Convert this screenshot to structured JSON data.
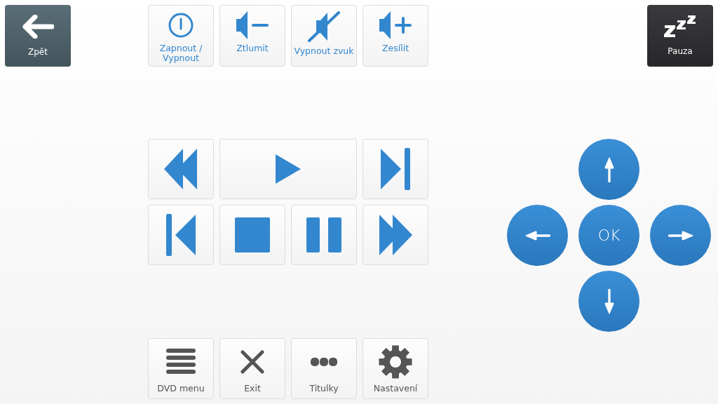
{
  "back_button": {
    "label": "Zpět"
  },
  "pause_button": {
    "label": "Pauza"
  },
  "top_buttons": [
    {
      "label": "Zapnout / Vypnout",
      "kind": "power"
    },
    {
      "label": "Ztlumit",
      "kind": "volume-down"
    },
    {
      "label": "Vypnout zvuk",
      "kind": "mute"
    },
    {
      "label": "Zesílit",
      "kind": "volume-up"
    }
  ],
  "transport_buttons": [
    {
      "kind": "rewind",
      "wide": false
    },
    {
      "kind": "play",
      "wide": true
    },
    {
      "kind": "next",
      "wide": false
    },
    {
      "kind": "previous",
      "wide": false
    },
    {
      "kind": "stop",
      "wide": false
    },
    {
      "kind": "pause",
      "wide": false
    },
    {
      "kind": "fast-forward",
      "wide": false
    }
  ],
  "dpad": {
    "ok_label": "OK"
  },
  "bottom_buttons": [
    {
      "label": "DVD menu",
      "kind": "menu"
    },
    {
      "label": "Exit",
      "kind": "close"
    },
    {
      "label": "Titulky",
      "kind": "dots"
    },
    {
      "label": "Nastavení",
      "kind": "gear"
    }
  ]
}
